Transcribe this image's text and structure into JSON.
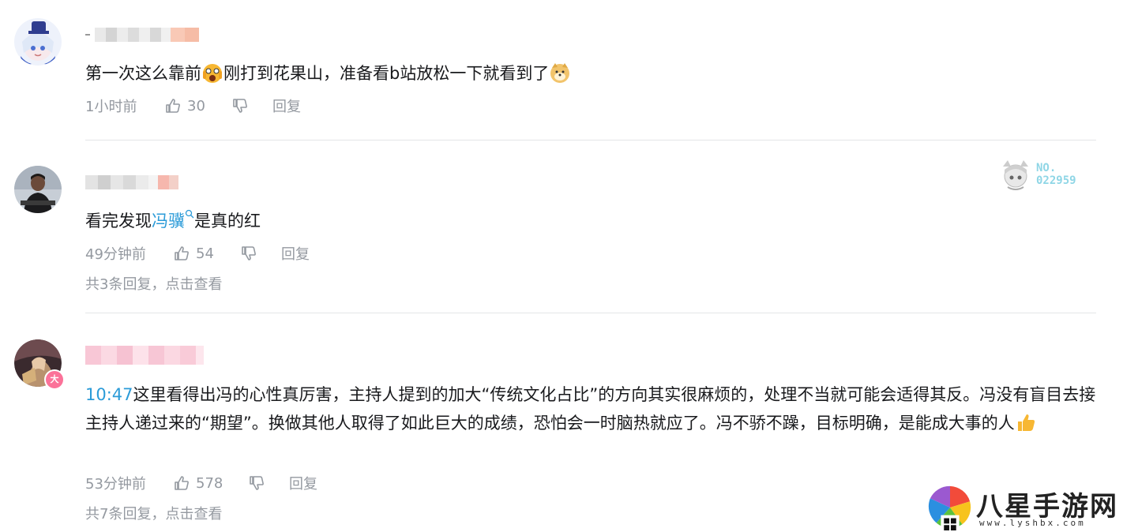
{
  "comments": [
    {
      "text_before": "第一次这么靠前",
      "text_mid": "刚打到花果山，准备看b站放松一下就看到了",
      "time": "1小时前",
      "likes": "30",
      "reply": "回复"
    },
    {
      "text_before": "看完发现",
      "link": "冯骥",
      "text_after": "是真的红",
      "time": "49分钟前",
      "likes": "54",
      "reply": "回复",
      "sub_replies": "共3条回复，点击查看",
      "badge_no_1": "NO.",
      "badge_no_2": "022959"
    },
    {
      "timestamp_link": "10:47",
      "text": "这里看得出冯的心性真厉害，主持人提到的加大“传统文化占比”的方向其实很麻烦的，处理不当就可能会适得其反。冯没有盲目去接主持人递过来的“期望”。换做其他人取得了如此巨大的成绩，恐怕会一时脑热就应了。冯不骄不躁，目标明确，是能成大事的人",
      "time": "53分钟前",
      "likes": "578",
      "reply": "回复",
      "sub_replies": "共7条回复，点击查看",
      "avatar_badge": "大"
    }
  ],
  "watermark": {
    "title": "八星手游网",
    "url": "www.lyshbx.com"
  },
  "colors": {
    "link": "#2b9bd8",
    "meta": "#9499a0",
    "divider": "#e3e5e7"
  }
}
